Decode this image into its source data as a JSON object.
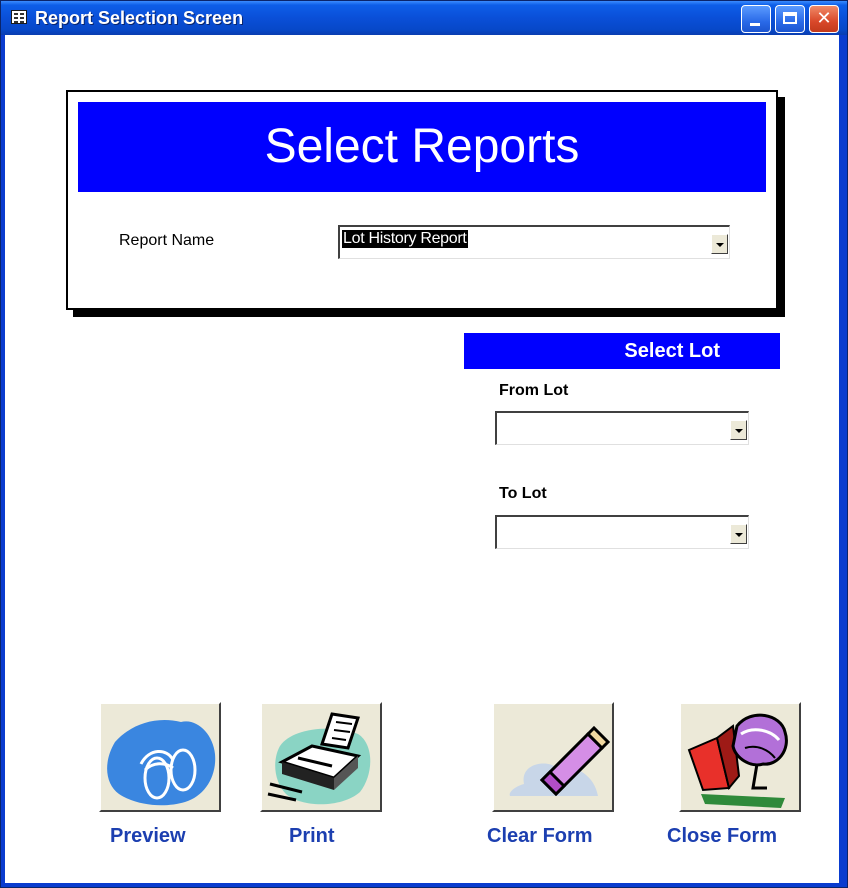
{
  "window": {
    "title": "Report Selection Screen"
  },
  "form": {
    "banner_title": "Select Reports",
    "report_name_label": "Report Name",
    "report_name_value": "Lot History Report",
    "select_lot_heading": "Select Lot",
    "from_lot_label": "From Lot",
    "from_lot_value": "",
    "to_lot_label": "To Lot",
    "to_lot_value": ""
  },
  "buttons": {
    "preview": {
      "label": "Preview",
      "icon": "binoculars-icon"
    },
    "print": {
      "label": "Print",
      "icon": "printer-icon"
    },
    "clear_form": {
      "label": "Clear Form",
      "icon": "eraser-icon"
    },
    "close_form": {
      "label": "Close Form",
      "icon": "exit-door-icon"
    }
  },
  "colors": {
    "title_bar": "#0a4fd8",
    "banner": "#0000ff",
    "caption_text": "#1c3fb0"
  }
}
